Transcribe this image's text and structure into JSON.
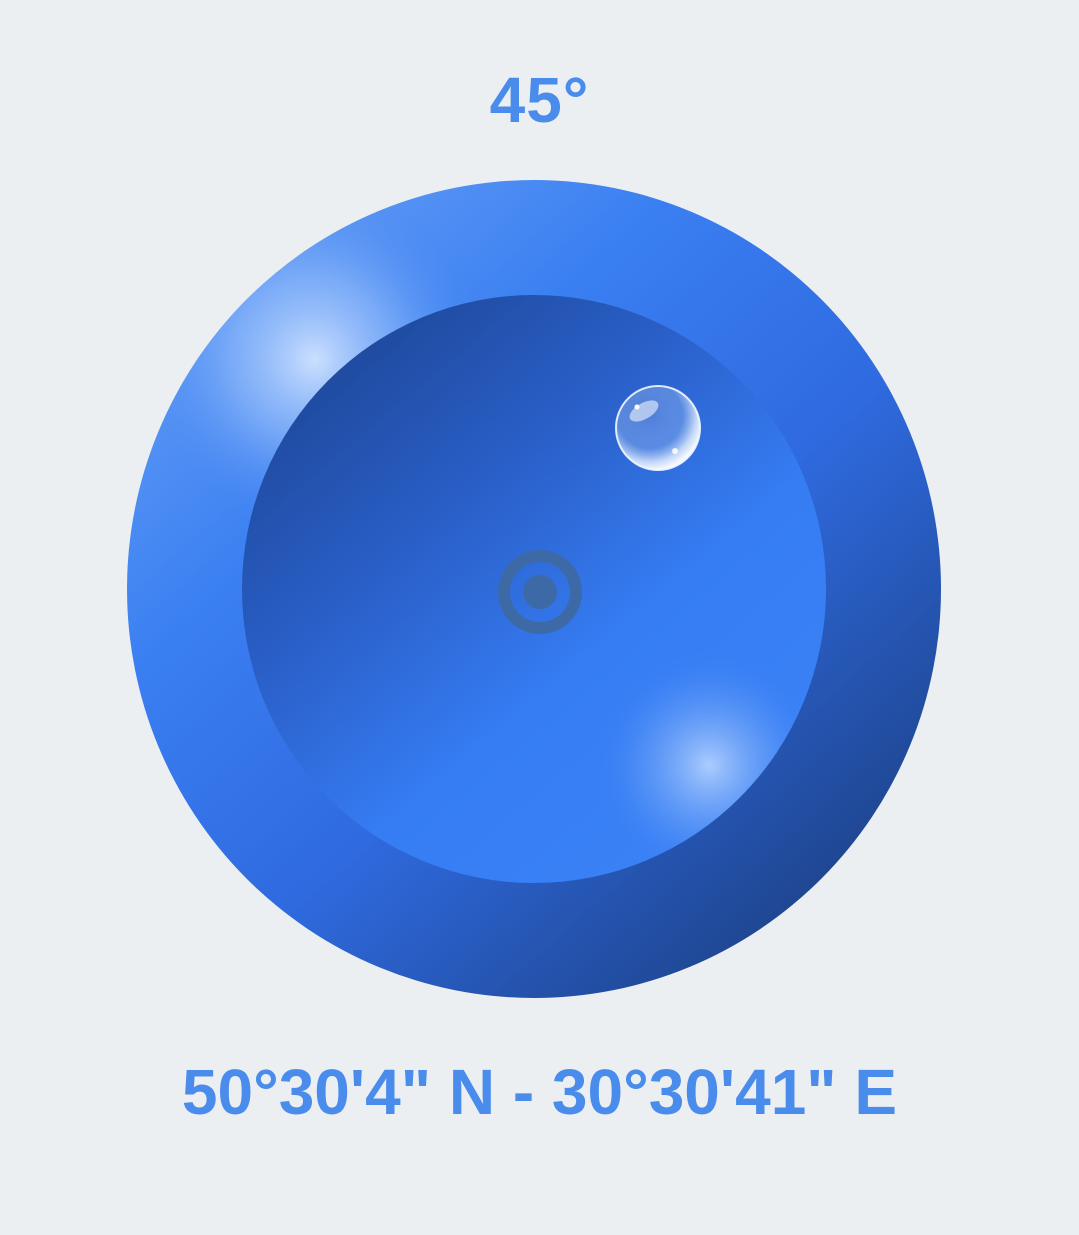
{
  "level": {
    "angle_label": "45°",
    "coordinates_label": "50°30'4\" N - 30°30'41\" E",
    "bubble_icon": "bubble-icon",
    "center_icon": "target-icon",
    "colors": {
      "background": "#ECEFF1",
      "accent_text": "#4A8CEB",
      "dial_primary": "#367DF4",
      "dial_dark": "#1C3F82",
      "dial_highlight": "#BFD8FF",
      "target": "#3D6AA7"
    }
  }
}
